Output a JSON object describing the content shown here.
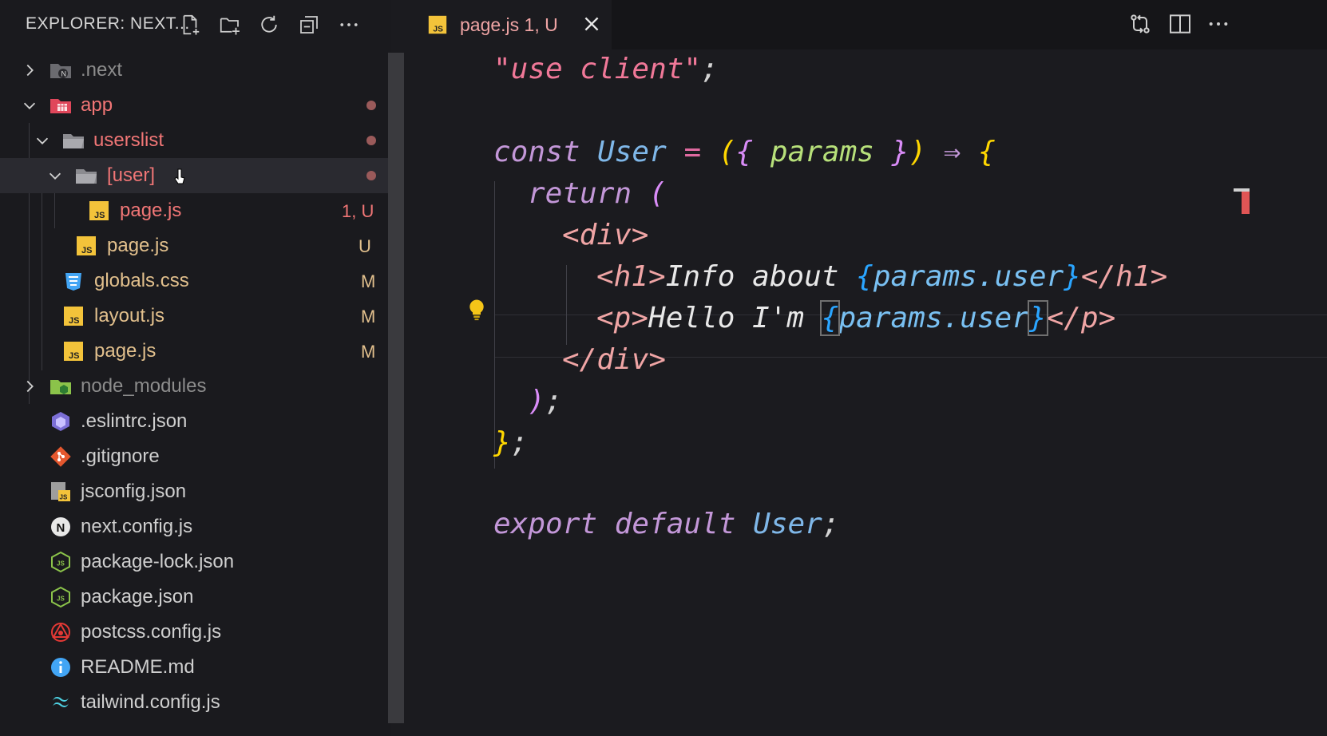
{
  "sidebar": {
    "title": "EXPLORER: NEXT...",
    "actions": [
      {
        "name": "new-file-icon",
        "label": "New File"
      },
      {
        "name": "new-folder-icon",
        "label": "New Folder"
      },
      {
        "name": "refresh-icon",
        "label": "Refresh Explorer"
      },
      {
        "name": "collapse-all-icon",
        "label": "Collapse Folders"
      },
      {
        "name": "more-actions-icon",
        "label": "More Actions"
      }
    ],
    "tree": [
      {
        "label": ".next",
        "badge": "",
        "icon": "folder-next-icon",
        "expanded": false
      },
      {
        "label": "app",
        "badge": "",
        "icon": "folder-app-icon",
        "expanded": true
      },
      {
        "label": "userslist",
        "badge": "",
        "icon": "folder-open-icon",
        "expanded": true
      },
      {
        "label": "[user]",
        "badge": "",
        "icon": "folder-open-icon",
        "expanded": true
      },
      {
        "label": "page.js",
        "badge": "1, U",
        "icon": "js-file-icon"
      },
      {
        "label": "page.js",
        "badge": "U",
        "icon": "js-file-icon"
      },
      {
        "label": "globals.css",
        "badge": "M",
        "icon": "css-file-icon"
      },
      {
        "label": "layout.js",
        "badge": "M",
        "icon": "js-file-icon"
      },
      {
        "label": "page.js",
        "badge": "M",
        "icon": "js-file-icon"
      },
      {
        "label": "node_modules",
        "badge": "",
        "icon": "folder-node-icon",
        "expanded": false
      },
      {
        "label": ".eslintrc.json",
        "badge": "",
        "icon": "eslint-icon"
      },
      {
        "label": ".gitignore",
        "badge": "",
        "icon": "git-icon"
      },
      {
        "label": "jsconfig.json",
        "badge": "",
        "icon": "jsconfig-icon"
      },
      {
        "label": "next.config.js",
        "badge": "",
        "icon": "next-icon"
      },
      {
        "label": "package-lock.json",
        "badge": "",
        "icon": "nodejs-icon"
      },
      {
        "label": "package.json",
        "badge": "",
        "icon": "nodejs-icon"
      },
      {
        "label": "postcss.config.js",
        "badge": "",
        "icon": "postcss-icon"
      },
      {
        "label": "README.md",
        "badge": "",
        "icon": "info-icon"
      },
      {
        "label": "tailwind.config.js",
        "badge": "",
        "icon": "tailwind-icon"
      }
    ]
  },
  "tab": {
    "title": "page.js 1, U",
    "close_label": "×"
  },
  "editor_actions": [
    {
      "name": "open-changes-icon"
    },
    {
      "name": "split-editor-icon"
    },
    {
      "name": "more-actions-icon"
    }
  ],
  "code": {
    "line1": {
      "str": "\"use client\"",
      "semi": ";"
    },
    "line3": {
      "kw": "const",
      "name": "User",
      "eq": "=",
      "lp": "(",
      "lb": "{",
      "param": "params",
      "rb": "}",
      "rp": ")",
      "arrow": "⇒",
      "ob": "{"
    },
    "line4": {
      "kw": "return",
      "paren": "("
    },
    "line5": {
      "tag": "<div>"
    },
    "line6": {
      "open": "<h1>",
      "text": "Info about ",
      "lb": "{",
      "expr": "params.user",
      "rb": "}",
      "close": "</h1>"
    },
    "line7": {
      "open": "<p>",
      "text": "Hello I'm ",
      "lb": "{",
      "expr": "params.user",
      "rb": "}",
      "close": "</p>"
    },
    "line8": {
      "tag": "</div>"
    },
    "line9": {
      "paren": ")",
      "semi": ";"
    },
    "line10": {
      "brace": "}",
      "semi": ";"
    },
    "line12": {
      "kw1": "export",
      "kw2": "default",
      "name": "User",
      "semi": ";"
    }
  }
}
